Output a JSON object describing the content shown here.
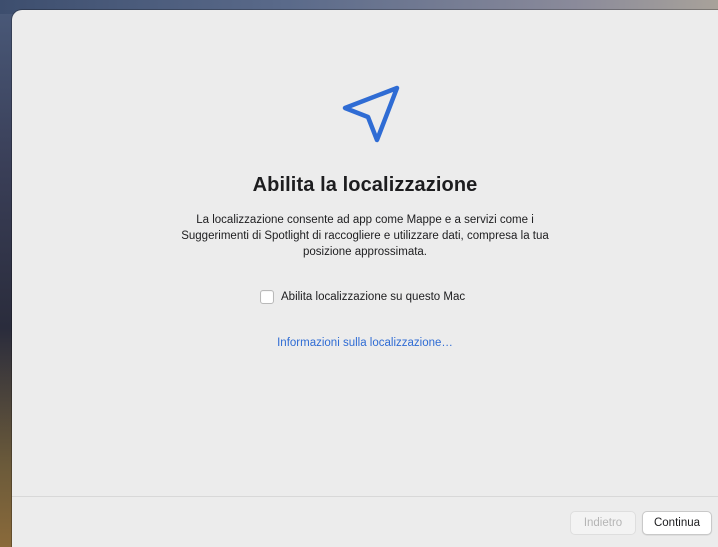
{
  "screen": {
    "title": "Abilita la localizzazione",
    "description": "La localizzazione consente ad app come Mappe e a servizi come i Suggerimenti di Spotlight di raccogliere e utilizzare dati, compresa la tua posizione approssimata.",
    "icon": "location-arrow-icon",
    "accent_color": "#2f6cd4"
  },
  "checkbox": {
    "label": "Abilita localizzazione su questo Mac",
    "checked": false
  },
  "link": {
    "label": "Informazioni sulla localizzazione…"
  },
  "footer": {
    "back_label": "Indietro",
    "back_enabled": false,
    "continue_label": "Continua"
  }
}
